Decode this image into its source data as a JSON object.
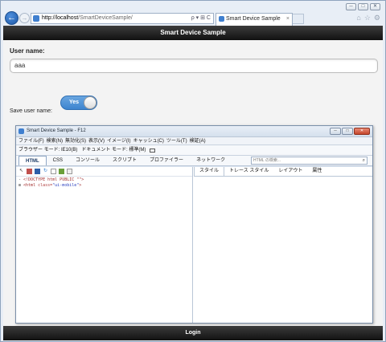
{
  "browser": {
    "address_host": "http://localhost",
    "address_path": "/SmartDeviceSample/",
    "address_tools": "ρ ▾ ⊞ C",
    "tab_title": "Smart Device Sample",
    "tab_close": "×",
    "win_buttons": [
      "─",
      "□",
      "✕"
    ],
    "chrome_icons": [
      "⌂",
      "☆",
      "⚙"
    ],
    "back_glyph": "←",
    "fwd_glyph": "→"
  },
  "app": {
    "header_title": "Smart Device Sample",
    "user_name_label": "User name:",
    "user_name_value": "aaa",
    "save_user_label": "Save user name:",
    "save_user_toggle": "Yes",
    "footer_button": "Login"
  },
  "devtools": {
    "title": "Smart Device Sample - F12",
    "win_buttons": [
      "─",
      "□",
      "✕"
    ],
    "menu": [
      "ファイル(F)",
      "検索(N)",
      "無効化(S)",
      "表示(V)",
      "イメージ(I)",
      "キャッシュ(C)",
      "ツール(T)",
      "検証(A)"
    ],
    "browser_mode": "ブラウザー モード: IE10(B)",
    "document_mode": "ドキュメント モード: 標準(M)",
    "tabs": [
      "HTML",
      "CSS",
      "コンソール",
      "スクリプト",
      "プロファイラー",
      "ネットワーク"
    ],
    "search_placeholder": "HTML の検索...",
    "tree": [
      {
        "prefix": "-",
        "text": "<!DOCTYPE html PUBLIC \"\">"
      },
      {
        "prefix": "⊞",
        "tag": "<html ",
        "attr": "class=",
        "val": "\"ui-mobile\"",
        "close": ">"
      }
    ],
    "right_tabs": [
      "スタイル",
      "トレース スタイル",
      "レイアウト",
      "属性"
    ]
  },
  "colors": {
    "header_bg": "#1a1a1a",
    "toggle_on": "#4a8fd6",
    "devtools_frame": "#dbe5f1",
    "nav_back": "#2a6bc0"
  }
}
